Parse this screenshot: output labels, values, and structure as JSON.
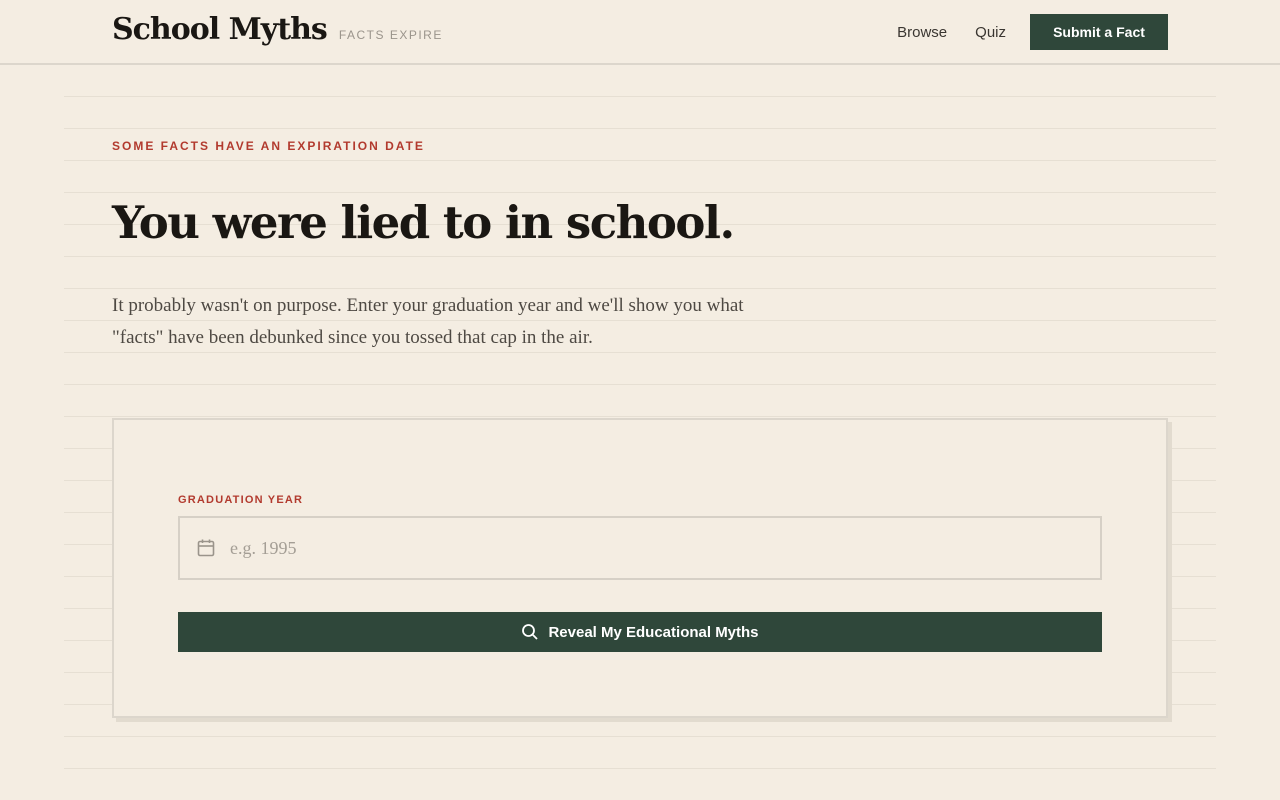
{
  "header": {
    "brand_title": "School Myths",
    "brand_tagline": "FACTS EXPIRE",
    "nav": {
      "browse": "Browse",
      "quiz": "Quiz",
      "submit": "Submit a Fact"
    }
  },
  "hero": {
    "eyebrow": "SOME FACTS HAVE AN EXPIRATION DATE",
    "headline": "You were lied to in school.",
    "lede": "It probably wasn't on purpose. Enter your graduation year and we'll show you what \"facts\" have been debunked since you tossed that cap in the air."
  },
  "form": {
    "field_label": "GRADUATION YEAR",
    "input_value": "",
    "input_placeholder": "e.g. 1995",
    "input_icon": "calendar-icon",
    "button_label": "Reveal My Educational Myths",
    "button_icon": "search-icon"
  },
  "colors": {
    "background": "#f4ede2",
    "accent_red": "#b23a2e",
    "primary_green": "#2f473a",
    "text_dark": "#1a1713",
    "text_muted": "#4e4943"
  }
}
